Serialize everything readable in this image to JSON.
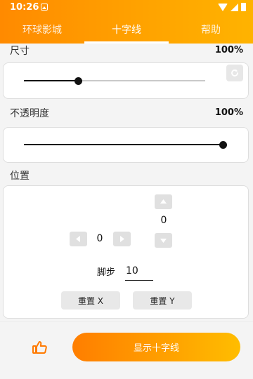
{
  "status_bar": {
    "time": "10:26"
  },
  "tabs": [
    {
      "label": "环球影城",
      "active": false
    },
    {
      "label": "十字线",
      "active": true
    },
    {
      "label": "帮助",
      "active": false
    }
  ],
  "size": {
    "label": "尺寸",
    "value_text": "100%",
    "slider_fraction": 0.3
  },
  "opacity": {
    "label": "不透明度",
    "value_text": "100%",
    "slider_fraction": 1.0
  },
  "position": {
    "label": "位置",
    "x_value": "0",
    "y_value": "0",
    "step_label": "脚步",
    "step_value": "10",
    "reset_x_label": "重置 X",
    "reset_y_label": "重置 Y"
  },
  "actions": {
    "show_crosshair_label": "显示十字线"
  },
  "icons": {
    "reset": "refresh-icon",
    "left": "arrow-left-icon",
    "right": "arrow-right-icon",
    "up": "arrow-up-icon",
    "down": "arrow-down-icon",
    "like": "thumbs-up-icon"
  },
  "colors": {
    "accent_start": "#ff8a00",
    "accent_end": "#ffb300",
    "like_icon": "#ff7a00"
  }
}
